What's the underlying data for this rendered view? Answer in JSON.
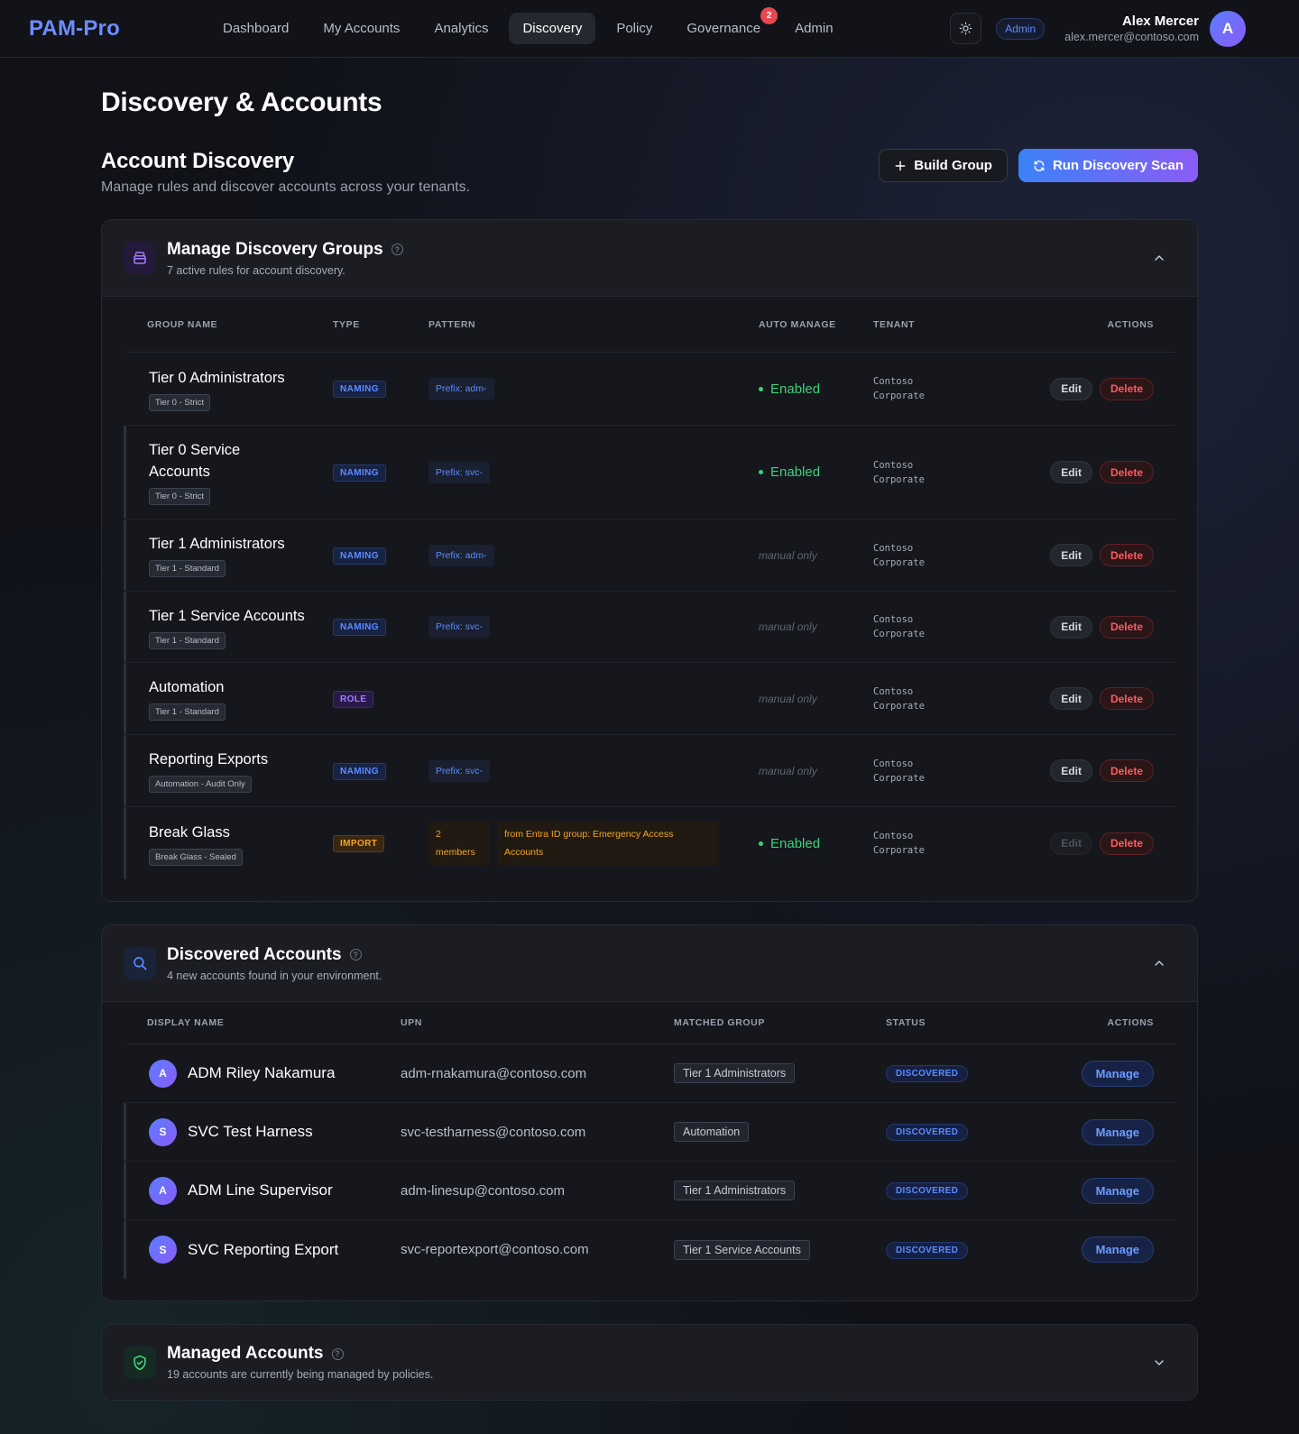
{
  "app": {
    "logo": "PAM-Pro",
    "nav": [
      {
        "label": "Dashboard"
      },
      {
        "label": "My Accounts"
      },
      {
        "label": "Analytics"
      },
      {
        "label": "Discovery",
        "active": true
      },
      {
        "label": "Policy"
      },
      {
        "label": "Governance",
        "badge": "2"
      },
      {
        "label": "Admin"
      }
    ],
    "role": "Admin",
    "user": {
      "name": "Alex Mercer",
      "email": "alex.mercer@contoso.com",
      "initial": "A"
    }
  },
  "page": {
    "title": "Discovery & Accounts",
    "section_title": "Account Discovery",
    "section_subtitle": "Manage rules and discover accounts across your tenants.",
    "build_group_label": "Build Group",
    "run_scan_label": "Run Discovery Scan"
  },
  "groups_card": {
    "title": "Manage Discovery Groups",
    "subtitle": "7 active rules for account discovery.",
    "headers": {
      "name": "GROUP NAME",
      "type": "TYPE",
      "pattern": "PATTERN",
      "auto": "AUTO MANAGE",
      "tenant": "TENANT",
      "actions": "ACTIONS"
    },
    "edit_label": "Edit",
    "delete_label": "Delete",
    "rows": [
      {
        "name": "Tier 0 Administrators",
        "tier": "Tier 0 - Strict",
        "type": "NAMING",
        "pattern": "Prefix: adm-",
        "auto": "Enabled",
        "tenant_1": "Contoso",
        "tenant_2": "Corporate"
      },
      {
        "name": "Tier 0 Service Accounts",
        "tier": "Tier 0 - Strict",
        "type": "NAMING",
        "pattern": "Prefix: svc-",
        "auto": "Enabled",
        "tenant_1": "Contoso",
        "tenant_2": "Corporate"
      },
      {
        "name": "Tier 1 Administrators",
        "tier": "Tier 1 - Standard",
        "type": "NAMING",
        "pattern": "Prefix: adm-",
        "auto": "manual only",
        "tenant_1": "Contoso",
        "tenant_2": "Corporate"
      },
      {
        "name": "Tier 1 Service Accounts",
        "tier": "Tier 1 - Standard",
        "type": "NAMING",
        "pattern": "Prefix: svc-",
        "auto": "manual only",
        "tenant_1": "Contoso",
        "tenant_2": "Corporate"
      },
      {
        "name": "Automation",
        "tier": "Tier 1 - Standard",
        "type": "ROLE",
        "pattern": "",
        "auto": "manual only",
        "tenant_1": "Contoso",
        "tenant_2": "Corporate"
      },
      {
        "name": "Reporting Exports",
        "tier": "Automation - Audit Only",
        "type": "NAMING",
        "pattern": "Prefix: svc-",
        "auto": "manual only",
        "tenant_1": "Contoso",
        "tenant_2": "Corporate"
      },
      {
        "name": "Break Glass",
        "tier": "Break Glass - Sealed",
        "type": "IMPORT",
        "members_1": "2",
        "members_2": "members",
        "import_1": "from Entra ID group: Emergency Access",
        "import_2": "Accounts",
        "auto": "Enabled",
        "tenant_1": "Contoso",
        "tenant_2": "Corporate"
      }
    ]
  },
  "discovered_card": {
    "title": "Discovered Accounts",
    "subtitle": "4 new accounts found in your environment.",
    "headers": {
      "name": "DISPLAY NAME",
      "upn": "UPN",
      "group": "MATCHED GROUP",
      "status": "STATUS",
      "actions": "ACTIONS"
    },
    "manage_label": "Manage",
    "rows": [
      {
        "initial": "A",
        "name": "ADM Riley Nakamura",
        "upn": "adm-rnakamura@contoso.com",
        "group": "Tier 1 Administrators",
        "status": "DISCOVERED"
      },
      {
        "initial": "S",
        "name": "SVC Test Harness",
        "upn": "svc-testharness@contoso.com",
        "group": "Automation",
        "status": "DISCOVERED"
      },
      {
        "initial": "A",
        "name": "ADM Line Supervisor",
        "upn": "adm-linesup@contoso.com",
        "group": "Tier 1 Administrators",
        "status": "DISCOVERED"
      },
      {
        "initial": "S",
        "name": "SVC Reporting Export",
        "upn": "svc-reportexport@contoso.com",
        "group": "Tier 1 Service Accounts",
        "status": "DISCOVERED"
      }
    ]
  },
  "managed_card": {
    "title": "Managed Accounts",
    "subtitle": "19 accounts are currently being managed by policies."
  },
  "colors": {
    "accent": "#5b8cff",
    "primary_gradient_start": "#3b82f6",
    "primary_gradient_end": "#8b5cf6",
    "enabled": "#3fd07a",
    "danger": "#ff5a5f",
    "import": "#f5a524"
  }
}
